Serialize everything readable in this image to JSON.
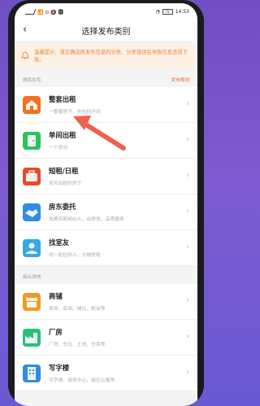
{
  "status": {
    "left": "📶 ⊙ 🔇 🅷",
    "battery": "72",
    "time": "14:53"
  },
  "header": {
    "title": "选择发布类别",
    "back": "‹"
  },
  "notice": {
    "text": "温馨提示：请正确选择发布信息的分类，分类错误会导致信息违规下架。"
  },
  "sections": [
    {
      "label": "居民住宅",
      "link": "发布规则",
      "items": [
        {
          "title": "整套出租",
          "sub": "一整套房子，也包括开间",
          "icon": "whole-house-icon",
          "color": "#f2701f"
        },
        {
          "title": "单间出租",
          "sub": "一个房间",
          "icon": "door-icon",
          "color": "#2bc25a"
        },
        {
          "title": "短租/日租",
          "sub": "按天出租的房子",
          "icon": "suitcase-icon",
          "color": "#e84b2a"
        },
        {
          "title": "房东委托",
          "sub": "免费匹配经纪人，出房快，品质服务",
          "icon": "handshake-icon",
          "color": "#2f8de4"
        },
        {
          "title": "找室友",
          "sub": "找一起住的人，分摊房租",
          "icon": "roommate-icon",
          "color": "#34a9e6"
        }
      ]
    },
    {
      "label": "商业用地",
      "items": [
        {
          "title": "商铺",
          "sub": "卖场、底商、摊位、柜台等",
          "icon": "shop-icon",
          "color": "#f29a1f"
        },
        {
          "title": "厂房",
          "sub": "厂房、车位、土地、仓库等",
          "icon": "factory-icon",
          "color": "#29c07a"
        },
        {
          "title": "写字楼",
          "sub": "写字楼、商务中心、商住公寓等",
          "icon": "office-building-icon",
          "color": "#2f8de4"
        }
      ]
    }
  ]
}
